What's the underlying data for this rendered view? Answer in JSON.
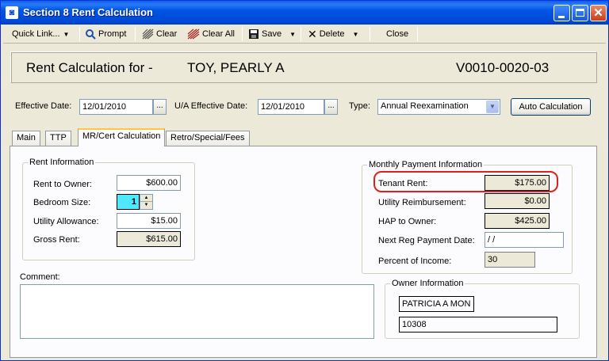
{
  "window": {
    "title": "Section 8 Rent Calculation",
    "app_icon": "app-icon"
  },
  "toolbar": {
    "quick_link": "Quick Link...",
    "prompt": "Prompt",
    "clear": "Clear",
    "clear_all": "Clear All",
    "save": "Save",
    "delete": "Delete",
    "close": "Close"
  },
  "header": {
    "label": "Rent Calculation for -",
    "tenant_name": "TOY, PEARLY A",
    "unit_id": "V0010-0020-03"
  },
  "dates": {
    "effective_label": "Effective Date:",
    "effective_value": "12/01/2010",
    "ua_effective_label": "U/A Effective Date:",
    "ua_effective_value": "12/01/2010",
    "type_label": "Type:",
    "type_value": "Annual Reexamination",
    "auto_calc": "Auto Calculation"
  },
  "tabs": [
    {
      "label": "Main"
    },
    {
      "label": "TTP"
    },
    {
      "label": "MR/Cert Calculation"
    },
    {
      "label": "Retro/Special/Fees"
    }
  ],
  "rent_info": {
    "title": "Rent Information",
    "rent_to_owner_label": "Rent to Owner:",
    "rent_to_owner": "$600.00",
    "bedroom_label": "Bedroom Size:",
    "bedroom": "1",
    "utility_label": "Utility Allowance:",
    "utility": "$15.00",
    "gross_label": "Gross Rent:",
    "gross": "$615.00"
  },
  "payment_info": {
    "title": "Monthly Payment Information",
    "tenant_rent_label": "Tenant Rent:",
    "tenant_rent": "$175.00",
    "utility_reimb_label": "Utility Reimbursement:",
    "utility_reimb": "$0.00",
    "hap_label": "HAP to Owner:",
    "hap": "$425.00",
    "next_reg_label": "Next Reg Payment Date:",
    "next_reg": " / /",
    "percent_label": "Percent of Income:",
    "percent": "30"
  },
  "comment": {
    "label": "Comment:",
    "value": ""
  },
  "owner_info": {
    "title": "Owner Information",
    "name": "PATRICIA A MON",
    "id": "10308"
  },
  "colors": {
    "title_bar": "#0055e5",
    "highlight": "#e0201c",
    "spin_focus": "#4fe8ff"
  }
}
